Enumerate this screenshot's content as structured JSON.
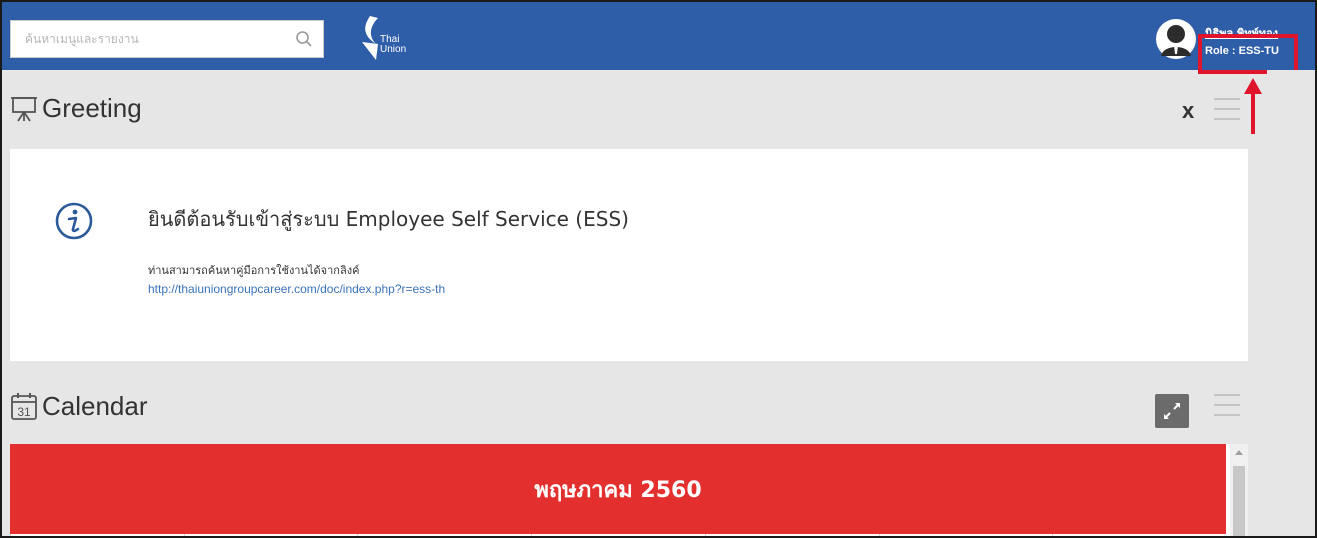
{
  "search": {
    "placeholder": "ค้นหาเมนูและรายงาน"
  },
  "logo": {
    "line1": "Thai",
    "line2": "Union"
  },
  "user": {
    "name": "นิธิพล พิทพ์ทอง",
    "role": "Role : ESS-TU"
  },
  "greeting": {
    "title": "Greeting",
    "close_label": "x",
    "heading": "ยินดีต้อนรับเข้าสู่ระบบ Employee Self Service (ESS)",
    "text": "ท่านสามารถค้นหาคู่มือการใช้งานได้จากลิงค์",
    "link": "http://thaiuniongroupcareer.com/doc/index.php?r=ess-th"
  },
  "calendar": {
    "title": "Calendar",
    "icon_day": "31",
    "month": "พฤษภาคม 2560"
  },
  "colors": {
    "topbar": "#2f5ea8",
    "highlight": "#e0142b",
    "month_bar": "#e3302f",
    "link": "#3a73b8"
  },
  "icons": [
    "search-icon",
    "thai-union-logo",
    "user-avatar-icon",
    "presentation-board-icon",
    "info-icon",
    "menu-icon",
    "calendar-icon",
    "expand-icon",
    "up-arrow-annotation"
  ]
}
